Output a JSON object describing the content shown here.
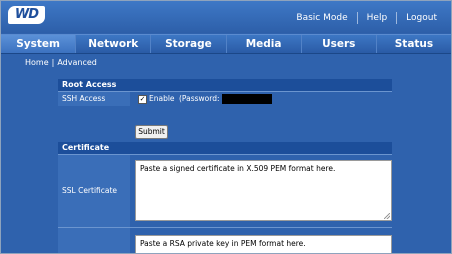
{
  "brand": {
    "logo_text": "WD"
  },
  "top_links": [
    "Basic Mode",
    "Help",
    "Logout"
  ],
  "tabs": [
    {
      "label": "System",
      "active": true
    },
    {
      "label": "Network",
      "active": false
    },
    {
      "label": "Storage",
      "active": false
    },
    {
      "label": "Media",
      "active": false
    },
    {
      "label": "Users",
      "active": false
    },
    {
      "label": "Status",
      "active": false
    }
  ],
  "breadcrumb": [
    "Home",
    "Advanced"
  ],
  "root_access": {
    "title": "Root Access",
    "ssh_label": "SSH Access",
    "enable_checked": true,
    "enable_label": "Enable",
    "password_label": "(Password:",
    "submit_label": "Submit"
  },
  "certificate": {
    "title": "Certificate",
    "ssl_label": "SSL Certificate",
    "ssl_placeholder": "Paste a signed certificate in X.509 PEM format here.",
    "key_placeholder": "Paste a RSA private key in PEM format here."
  },
  "colors": {
    "accent": "#2f62ad",
    "header": "#1c4e9a"
  },
  "icons": {
    "checkbox": "checkmark-icon"
  }
}
